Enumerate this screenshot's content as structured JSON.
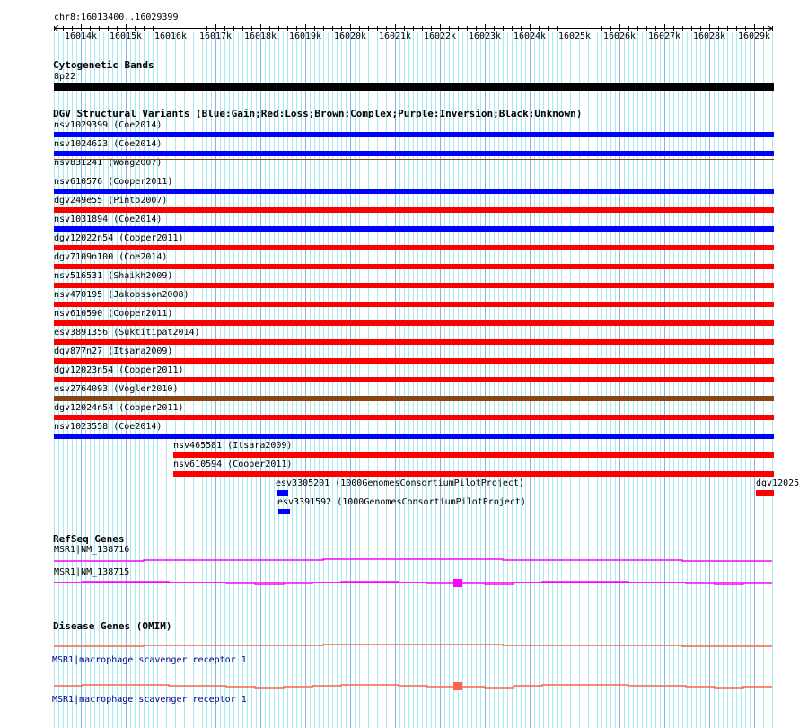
{
  "ruler": {
    "location": "chr8:16013400..16029399",
    "start": 16013400,
    "end": 16029399,
    "tick_labels": [
      "16014k",
      "16015k",
      "16016k",
      "16017k",
      "16018k",
      "16019k",
      "16020k",
      "16021k",
      "16022k",
      "16023k",
      "16024k",
      "16025k",
      "16026k",
      "16027k",
      "16028k",
      "16029k"
    ]
  },
  "cyto": {
    "title": "Cytogenetic Bands",
    "band": "8p22",
    "color": "#000000"
  },
  "dgv": {
    "title": "DGV Structural Variants (Blue:Gain;Red:Loss;Brown:Complex;Purple:Inversion;Black:Unknown)",
    "colors": {
      "gain": "#0000ff",
      "loss": "#ff0000",
      "complex": "#8b4513"
    },
    "items": [
      {
        "label": "nsv1029399 (Coe2014)",
        "type": "gain",
        "start": 16013400,
        "end": 16029399
      },
      {
        "label": "nsv1024623 (Coe2014)",
        "type": "gain",
        "start": 16013400,
        "end": 16029399
      },
      {
        "label": "nsv831241 (Wong2007)",
        "type": "complex",
        "start": 16013400,
        "end": 16029399,
        "thin": true
      },
      {
        "label": "nsv610576 (Cooper2011)",
        "type": "gain",
        "start": 16013400,
        "end": 16029399
      },
      {
        "label": "dgv249e55 (Pinto2007)",
        "type": "loss",
        "start": 16013400,
        "end": 16029399
      },
      {
        "label": "nsv1031894 (Coe2014)",
        "type": "gain",
        "start": 16013400,
        "end": 16029399
      },
      {
        "label": "dgv12022n54 (Cooper2011)",
        "type": "loss",
        "start": 16013400,
        "end": 16029399
      },
      {
        "label": "dgv7109n100 (Coe2014)",
        "type": "loss",
        "start": 16013400,
        "end": 16029399
      },
      {
        "label": "nsv516531 (Shaikh2009)",
        "type": "loss",
        "start": 16013400,
        "end": 16029399
      },
      {
        "label": "nsv470195 (Jakobsson2008)",
        "type": "loss",
        "start": 16013400,
        "end": 16029399
      },
      {
        "label": "nsv610590 (Cooper2011)",
        "type": "loss",
        "start": 16013400,
        "end": 16029399
      },
      {
        "label": "esv3891356 (Suktitipat2014)",
        "type": "loss",
        "start": 16013400,
        "end": 16029399
      },
      {
        "label": "dgv877n27 (Itsara2009)",
        "type": "loss",
        "start": 16013400,
        "end": 16029399
      },
      {
        "label": "dgv12023n54 (Cooper2011)",
        "type": "loss",
        "start": 16013400,
        "end": 16029399
      },
      {
        "label": "esv2764093 (Vogler2010)",
        "type": "complex",
        "start": 16013400,
        "end": 16029399
      },
      {
        "label": "dgv12024n54 (Cooper2011)",
        "type": "loss",
        "start": 16013400,
        "end": 16029399
      },
      {
        "label": "nsv1023558 (Coe2014)",
        "type": "gain",
        "start": 16013400,
        "end": 16029399
      },
      {
        "label": "nsv465581 (Itsara2009)",
        "type": "loss",
        "start": 16016060,
        "end": 16029399
      },
      {
        "label": "nsv610594 (Cooper2011)",
        "type": "loss",
        "start": 16016060,
        "end": 16029399
      },
      {
        "label": "esv3305201 (1000GenomesConsortiumPilotProject)",
        "type": "gain",
        "start": 16018360,
        "end": 16018580
      },
      {
        "label": "esv3391592 (1000GenomesConsortiumPilotProject)",
        "type": "gain",
        "start": 16018400,
        "end": 16018620
      },
      {
        "label": "dgv12025",
        "type": "loss",
        "start": 16029040,
        "end": 16029399
      }
    ]
  },
  "refseq": {
    "title": "RefSeq Genes",
    "color": "#ff00ff",
    "genes": [
      {
        "label": "MSR1|NM_138716"
      },
      {
        "label": "MSR1|NM_138715",
        "exon_start": 16022300,
        "exon_end": 16022500
      }
    ]
  },
  "omim": {
    "title": "Disease Genes (OMIM)",
    "color": "#ff6347",
    "genes": [
      {
        "label": "MSR1|macrophage scavenger receptor 1"
      },
      {
        "label": "MSR1|macrophage scavenger receptor 1",
        "exon_start": 16022300,
        "exon_end": 16022500
      }
    ]
  }
}
